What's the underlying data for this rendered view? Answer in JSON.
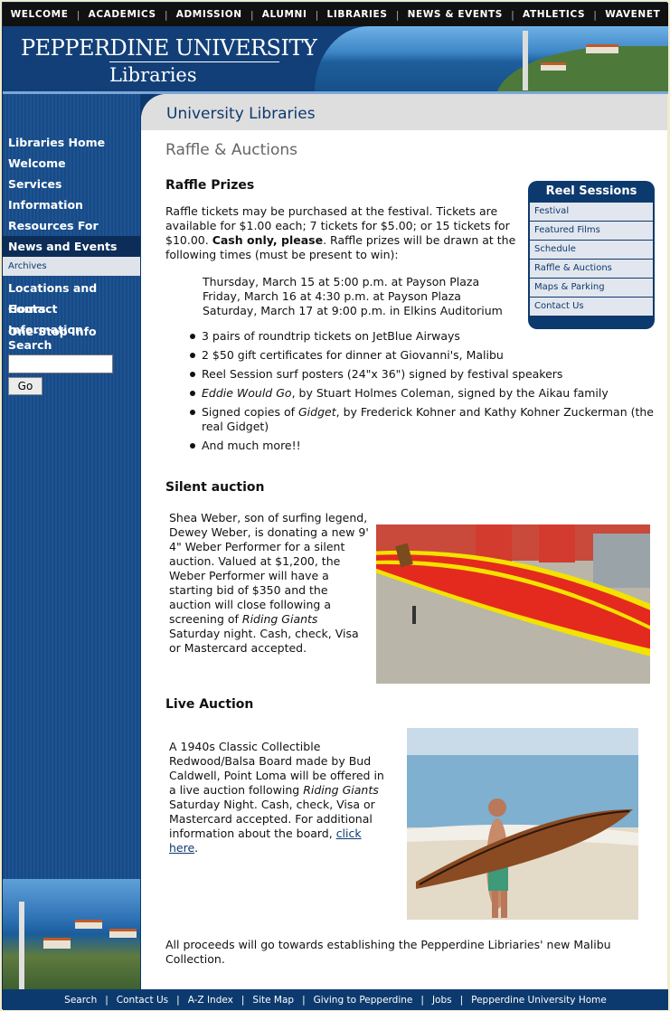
{
  "topnav": [
    "WELCOME",
    "ACADEMICS",
    "ADMISSION",
    "ALUMNI",
    "LIBRARIES",
    "NEWS & EVENTS",
    "ATHLETICS",
    "WAVENET"
  ],
  "banner": {
    "university": "PEPPERDINE UNIVERSITY",
    "libraries": "Libraries"
  },
  "sidebar": {
    "items": [
      "Libraries Home",
      "Welcome",
      "Services",
      "Information",
      "Resources For",
      "News and Events"
    ],
    "sub_item": "Archives",
    "items2": [
      "Locations and Hours",
      "Contact Information"
    ],
    "search_title": "One-Stop Info Search",
    "search_value": "",
    "go_label": "Go"
  },
  "content": {
    "header": "University Libraries",
    "page_title": "Raffle & Auctions",
    "raffle_heading": "Raffle Prizes",
    "raffle_p1": "Raffle tickets may be purchased at the festival. Tickets are available for $1.00 each; 7 tickets for $5.00; or 15 tickets for $10.00. ",
    "raffle_bold": "Cash only, please",
    "raffle_p2": ". Raffle prizes will be drawn at the following times (must be present to win):",
    "times": [
      "Thursday, March 15 at 5:00 p.m. at Payson Plaza",
      "Friday, March 16 at 4:30 p.m. at Payson Plaza",
      "Saturday, March 17 at 9:00 p.m. in Elkins Auditorium"
    ],
    "prizes": [
      {
        "pre": "3 pairs of roundtrip tickets on JetBlue Airways",
        "em": "",
        "post": ""
      },
      {
        "pre": "2 $50 gift certificates for dinner at Giovanni's, Malibu",
        "em": "",
        "post": ""
      },
      {
        "pre": "Reel Session surf posters (24\"x 36\") signed by festival speakers",
        "em": "",
        "post": ""
      },
      {
        "pre": "",
        "em": "Eddie Would Go",
        "post": ", by Stuart Holmes Coleman, signed by the Aikau family"
      },
      {
        "pre": "Signed copies of ",
        "em": "Gidget",
        "post": ", by Frederick Kohner and Kathy Kohner Zuckerman (the real Gidget)"
      },
      {
        "pre": "And much more!!",
        "em": "",
        "post": ""
      }
    ],
    "silent_heading": "Silent auction",
    "silent_text_1": "Shea Weber, son of surfing legend, Dewey Weber, is donating a new 9' 4\" Weber Performer for a silent auction. Valued at $1,200, the Weber Performer will have a starting bid of $350 and the auction will close following a screening of ",
    "silent_em": "Riding Giants",
    "silent_text_2": " Saturday night. Cash, check, Visa or Mastercard accepted.",
    "live_heading": "Live Auction",
    "live_text_1": "A 1940s Classic Collectible Redwood/Balsa Board made by Bud Caldwell, Point Loma will be offered in a live auction following ",
    "live_em": "Riding Giants",
    "live_text_2": " Saturday Night.  Cash, check, Visa or Mastercard accepted. For additional information about the board, ",
    "live_link": "click here",
    "live_text_3": ".",
    "closing": "All proceeds will go towards establishing the Pepperdine Libriaries' new Malibu Collection."
  },
  "reel_sessions": {
    "title": "Reel Sessions",
    "items": [
      "Festival",
      "Featured Films",
      "Schedule",
      "Raffle & Auctions",
      "Maps & Parking",
      "Contact Us"
    ]
  },
  "footer": [
    "Search",
    "Contact Us",
    "A-Z Index",
    "Site Map",
    "Giving to Pepperdine",
    "Jobs",
    "Pepperdine University Home"
  ]
}
